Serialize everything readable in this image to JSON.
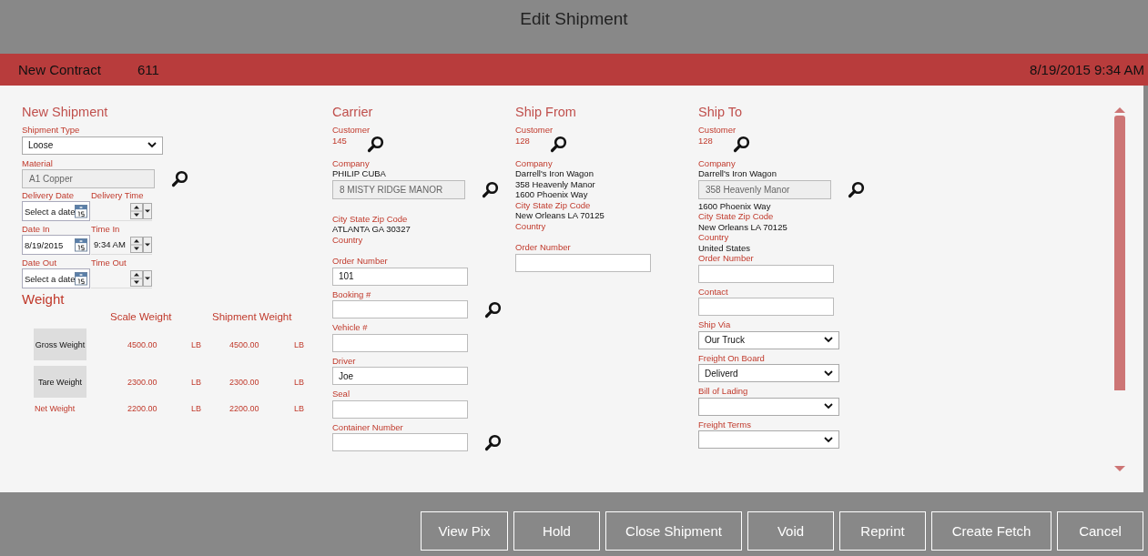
{
  "dialog": {
    "title": "Edit Shipment"
  },
  "header": {
    "contract": "New Contract",
    "number": "611",
    "datetime": "8/19/2015 9:34 AM"
  },
  "columns": [
    {
      "heading": "New Shipment",
      "items": [
        {
          "kind": "label",
          "text": "Shipment Type"
        },
        {
          "kind": "select",
          "value": "Loose"
        },
        {
          "kind": "label",
          "text": "Material"
        },
        {
          "kind": "readonly",
          "value": "A1 Copper",
          "search": true
        },
        {
          "kind": "datetime",
          "date_label": "Delivery Date",
          "time_label": "Delivery Time",
          "date_placeholder": "Select a date"
        },
        {
          "kind": "datetime",
          "date_label": "Date In",
          "time_label": "Time In",
          "date": "8/19/2015",
          "time": "9:34 AM"
        },
        {
          "kind": "datetime",
          "date_label": "Date Out",
          "time_label": "Time Out",
          "date_placeholder": "Select a date"
        }
      ]
    },
    {
      "heading": "Carrier",
      "items": [
        {
          "kind": "label",
          "text": "Customer"
        },
        {
          "kind": "link",
          "value": "145",
          "search": true
        },
        {
          "kind": "label",
          "text": "Company"
        },
        {
          "kind": "text",
          "text": "PHILIP CUBA"
        },
        {
          "kind": "readonly",
          "value": "8 MISTY RIDGE MANOR",
          "search": true
        },
        {
          "kind": "label",
          "text": "City State Zip Code"
        },
        {
          "kind": "text",
          "text": "ATLANTA GA 30327"
        },
        {
          "kind": "label",
          "text": "Country"
        },
        {
          "kind": "label",
          "text": "Order Number"
        },
        {
          "kind": "input",
          "value": "101"
        },
        {
          "kind": "label",
          "text": "Booking #"
        },
        {
          "kind": "input",
          "search": true
        },
        {
          "kind": "label",
          "text": "Vehicle #"
        },
        {
          "kind": "input"
        },
        {
          "kind": "label",
          "text": "Driver"
        },
        {
          "kind": "input",
          "value": "Joe"
        },
        {
          "kind": "label",
          "text": "Seal"
        },
        {
          "kind": "input"
        },
        {
          "kind": "label",
          "text": "Container Number"
        },
        {
          "kind": "input",
          "search": true
        }
      ]
    },
    {
      "heading": "Ship From",
      "items": [
        {
          "kind": "label",
          "text": "Customer"
        },
        {
          "kind": "link",
          "value": "128",
          "search": true
        },
        {
          "kind": "label",
          "text": "Company"
        },
        {
          "kind": "text",
          "text": "Darrell's Iron Wagon"
        },
        {
          "kind": "text",
          "text": "358 Heavenly Manor"
        },
        {
          "kind": "text",
          "text": "1600 Phoenix Way"
        },
        {
          "kind": "label",
          "text": "City State Zip Code"
        },
        {
          "kind": "text",
          "text": "New Orleans LA 70125"
        },
        {
          "kind": "label",
          "text": "Country"
        },
        {
          "kind": "label",
          "text": "Order Number"
        },
        {
          "kind": "input"
        }
      ]
    },
    {
      "heading": "Ship To",
      "items": [
        {
          "kind": "label",
          "text": "Customer"
        },
        {
          "kind": "link",
          "value": "128",
          "search": true
        },
        {
          "kind": "label",
          "text": "Company"
        },
        {
          "kind": "text",
          "text": "Darrell's Iron Wagon"
        },
        {
          "kind": "readonly",
          "value": "358 Heavenly Manor",
          "search": true
        },
        {
          "kind": "text",
          "text": "1600 Phoenix Way"
        },
        {
          "kind": "label",
          "text": "City State Zip Code"
        },
        {
          "kind": "text",
          "text": "New Orleans LA 70125"
        },
        {
          "kind": "label",
          "text": "Country"
        },
        {
          "kind": "text",
          "text": "United States"
        },
        {
          "kind": "label",
          "text": "Order Number"
        },
        {
          "kind": "input"
        },
        {
          "kind": "label",
          "text": "Contact"
        },
        {
          "kind": "input"
        },
        {
          "kind": "label",
          "text": "Ship Via"
        },
        {
          "kind": "select",
          "value": "Our Truck"
        },
        {
          "kind": "label",
          "text": "Freight On Board"
        },
        {
          "kind": "select",
          "value": "Deliverd"
        },
        {
          "kind": "label",
          "text": "Bill of Lading"
        },
        {
          "kind": "select"
        },
        {
          "kind": "label",
          "text": "Freight Terms"
        },
        {
          "kind": "select"
        }
      ]
    }
  ],
  "weight": {
    "heading": "Weight",
    "columns": [
      "Scale Weight",
      "Shipment Weight"
    ],
    "rows": [
      {
        "label": "Gross Weight",
        "kind": "button",
        "scale": "4500.00",
        "scale_unit": "LB",
        "shipment": "4500.00",
        "shipment_unit": "LB"
      },
      {
        "label": "Tare Weight",
        "kind": "button",
        "scale": "2300.00",
        "scale_unit": "LB",
        "shipment": "2300.00",
        "shipment_unit": "LB"
      },
      {
        "label": "Net Weight",
        "kind": "text",
        "scale": "2200.00",
        "scale_unit": "LB",
        "shipment": "2200.00",
        "shipment_unit": "LB"
      }
    ]
  },
  "buttons": [
    "View Pix",
    "Hold",
    "Close Shipment",
    "Void",
    "Reprint",
    "Create Fetch",
    "Cancel"
  ]
}
